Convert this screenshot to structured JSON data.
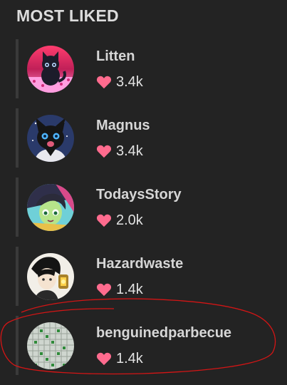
{
  "section": {
    "title": "MOST LIKED"
  },
  "users": [
    {
      "name": "Litten",
      "likes": "3.4k",
      "avatar": "black-cat-pink-background-avatar"
    },
    {
      "name": "Magnus",
      "likes": "3.4k",
      "avatar": "black-wolf-character-avatar"
    },
    {
      "name": "TodaysStory",
      "likes": "2.0k",
      "avatar": "green-haired-character-avatar"
    },
    {
      "name": "Hazardwaste",
      "likes": "1.4k",
      "avatar": "dark-haired-character-lantern-avatar"
    },
    {
      "name": "benguinedparbecue",
      "likes": "1.4k",
      "avatar": "minesweeper-grid-avatar"
    }
  ],
  "colors": {
    "background": "#232323",
    "heart": "#ff6b8e",
    "annotation": "#d41515"
  }
}
